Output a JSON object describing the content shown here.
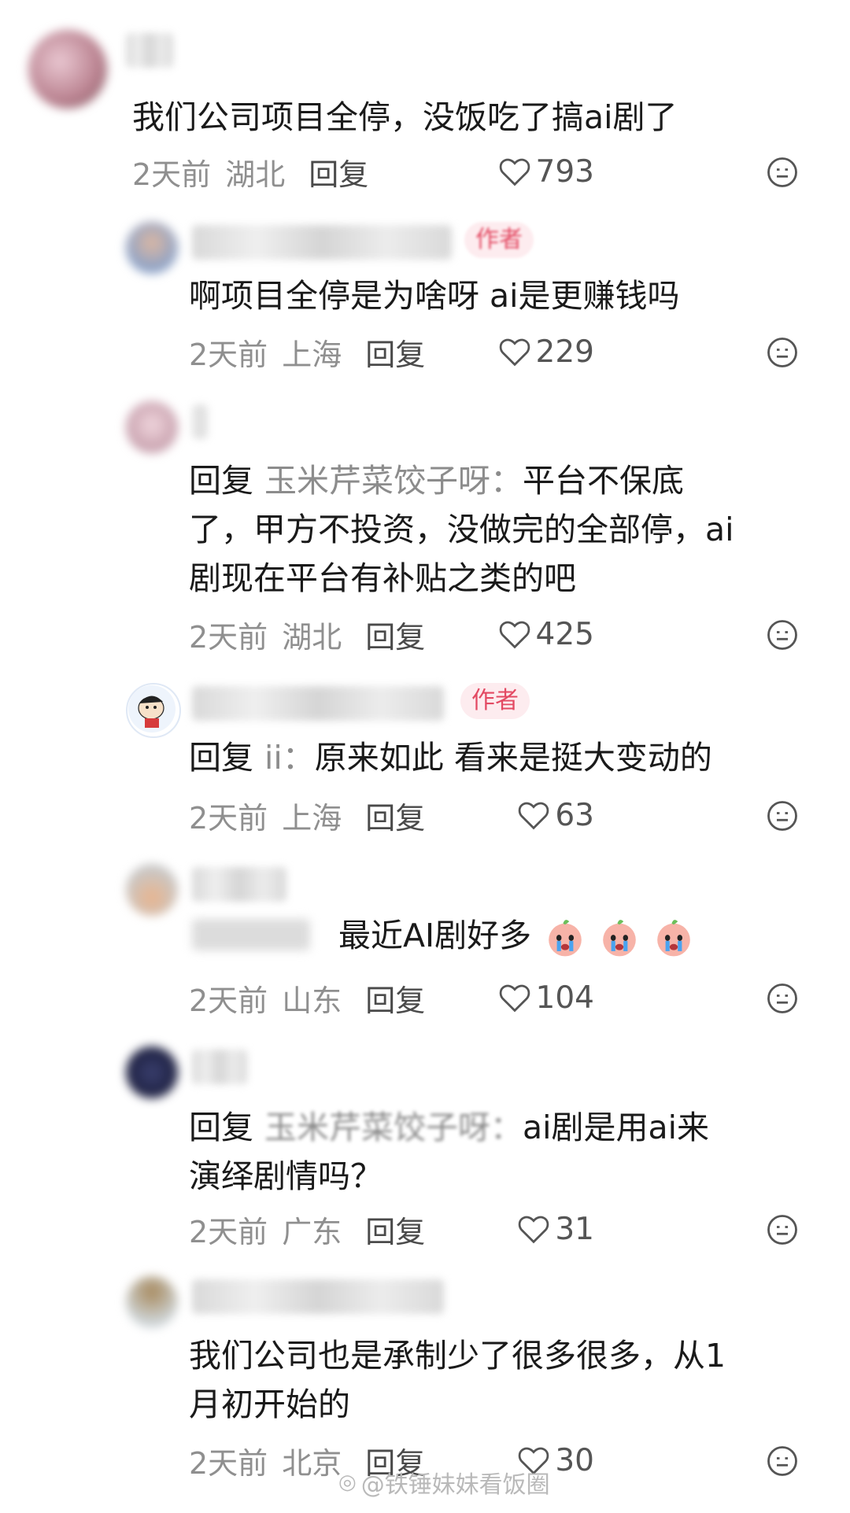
{
  "comments": [
    {
      "text": "我们公司项目全停，没饭吃了搞ai剧了",
      "time": "2天前",
      "location": "湖北",
      "reply_label": "回复",
      "likes": "793"
    },
    {
      "author_badge": "作者",
      "text": "啊项目全停是为啥呀 ai是更赚钱吗",
      "time": "2天前",
      "location": "上海",
      "reply_label": "回复",
      "likes": "229"
    },
    {
      "reply_prefix": "回复",
      "reply_target": "玉米芹菜饺子呀：",
      "text_line1": "平台不保底",
      "text_line2": "了，甲方不投资，没做完的全部停，ai",
      "text_line3": "剧现在平台有补贴之类的吧",
      "time": "2天前",
      "location": "湖北",
      "reply_label": "回复",
      "likes": "425"
    },
    {
      "author_badge": "作者",
      "reply_prefix": "回复",
      "reply_target": "ii：",
      "text": "原来如此 看来是挺大变动的",
      "time": "2天前",
      "location": "上海",
      "reply_label": "回复",
      "likes": "63"
    },
    {
      "text": "最近AI剧好多",
      "time": "2天前",
      "location": "山东",
      "reply_label": "回复",
      "likes": "104"
    },
    {
      "reply_prefix": "回复",
      "reply_target": "玉米芹菜饺子呀：",
      "text_line1": "ai剧是用ai来",
      "text_line2": "演绎剧情吗？",
      "time": "2天前",
      "location": "广东",
      "reply_label": "回复",
      "likes": "31"
    },
    {
      "text_line1": "我们公司也是承制少了很多很多，从1",
      "text_line2": "月初开始的",
      "time": "2天前",
      "location": "北京",
      "reply_label": "回复",
      "likes": "30"
    }
  ],
  "watermark": "@铁锤妹妹看饭圈",
  "icons": {
    "like": "heart-outline-icon",
    "dislike": "dislike-face-icon",
    "emoji": "crying-peach-emoji"
  },
  "colors": {
    "badge_bg": "#fdecef",
    "badge_text": "#e34a63",
    "meta": "#8f8f8f"
  }
}
